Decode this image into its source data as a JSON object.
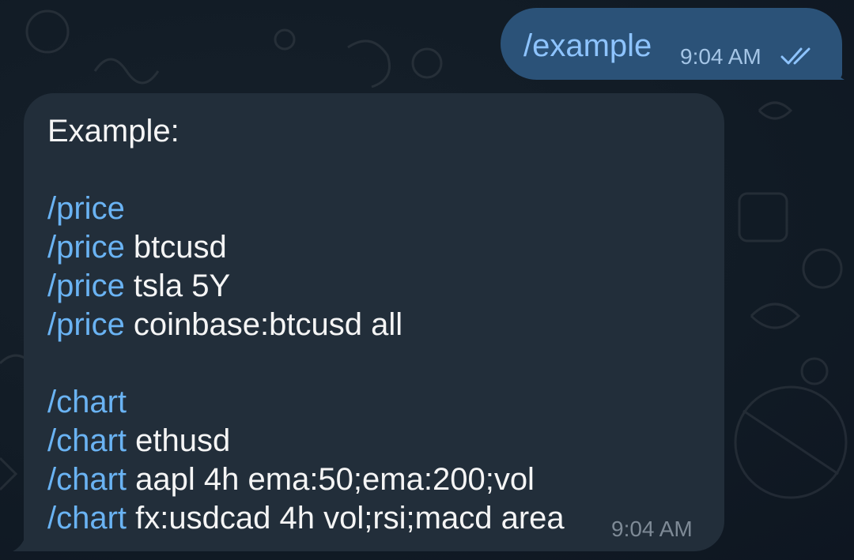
{
  "outgoing": {
    "text": "/example",
    "time": "9:04 AM",
    "status_icon": "double-check-icon"
  },
  "incoming": {
    "heading": "Example:",
    "lines": [
      {
        "cmd": "/price",
        "args": ""
      },
      {
        "cmd": "/price",
        "args": " btcusd"
      },
      {
        "cmd": "/price",
        "args": " tsla 5Y"
      },
      {
        "cmd": "/price",
        "args": " coinbase:btcusd all"
      },
      {
        "cmd": "/chart",
        "args": ""
      },
      {
        "cmd": "/chart",
        "args": " ethusd"
      },
      {
        "cmd": "/chart",
        "args": " aapl 4h ema:50;ema:200;vol"
      },
      {
        "cmd": "/chart",
        "args": " fx:usdcad 4h vol;rsi;macd area"
      }
    ],
    "time": "9:04 AM"
  },
  "colors": {
    "background": "#0e1621",
    "outgoing_bubble": "#2b5278",
    "incoming_bubble": "#222e3a",
    "link": "#6ab3f3",
    "text": "#f5f5f5"
  }
}
